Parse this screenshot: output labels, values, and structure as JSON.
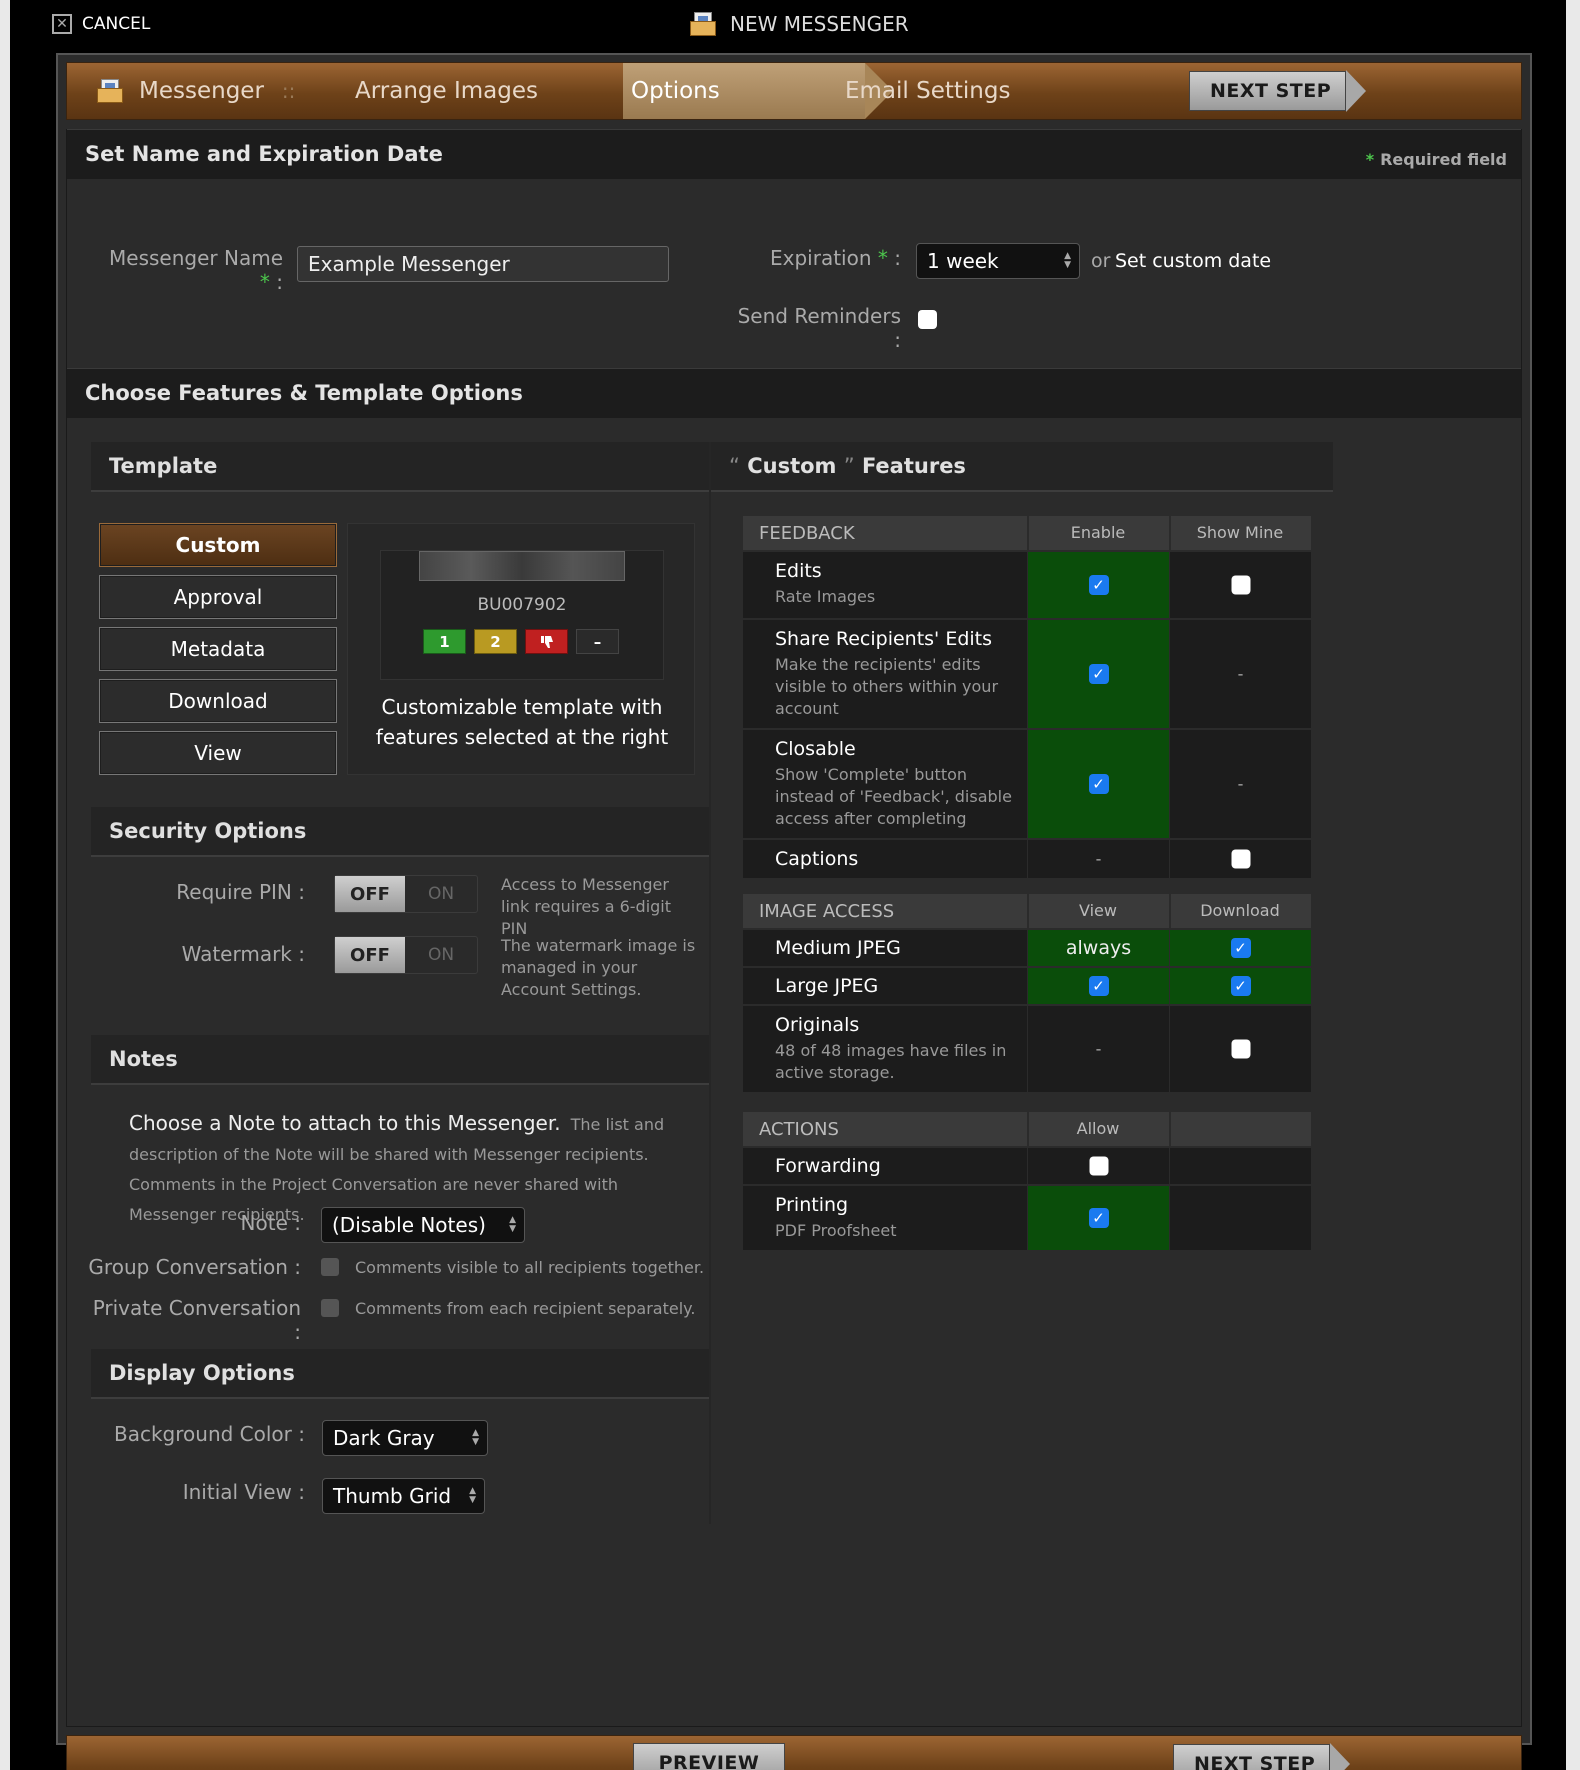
{
  "topbar": {
    "cancel_label": "CANCEL",
    "title": "NEW MESSENGER"
  },
  "steps": {
    "messenger": "Messenger",
    "separator": "::",
    "arrange": "Arrange Images",
    "options": "Options",
    "email": "Email Settings",
    "next_label": "NEXT STEP"
  },
  "section_name": {
    "title": "Set Name and Expiration Date",
    "required_star": "*",
    "required_label": "Required field",
    "name_label": "Messenger Name",
    "name_value": "Example Messenger",
    "expiration_label": "Expiration",
    "expiration_value": "1 week",
    "or_text": "or",
    "custom_date_link": "Set custom date",
    "reminders_label": "Send Reminders :",
    "colon": ":",
    "star": "*"
  },
  "section_features": {
    "title": "Choose Features & Template Options"
  },
  "template": {
    "title": "Template",
    "buttons": [
      "Custom",
      "Approval",
      "Metadata",
      "Download",
      "View"
    ],
    "active": "Custom",
    "preview_id": "BU007902",
    "preview_badges": [
      "1",
      "2",
      "",
      "–"
    ],
    "badge_colors": [
      "#2e9a2e",
      "#b99a22",
      "#c02020",
      "#2a2a2a"
    ],
    "description": "Customizable template with features selected at the right"
  },
  "security": {
    "title": "Security Options",
    "pin_label": "Require PIN :",
    "pin_off": "OFF",
    "pin_on": "ON",
    "pin_help": "Access to Messenger link requires a 6-digit PIN",
    "wm_label": "Watermark :",
    "wm_off": "OFF",
    "wm_on": "ON",
    "wm_help": "The watermark image is managed in your Account Settings."
  },
  "notes": {
    "title": "Notes",
    "lead": "Choose a Note to attach to this Messenger.",
    "desc": "The list and description of the Note will be shared with Messenger recipients. Comments in the Project Conversation are never shared with Messenger recipients.",
    "note_label": "Note :",
    "note_value": "(Disable Notes)",
    "group_label": "Group Conversation :",
    "group_help": "Comments visible to all recipients together.",
    "private_label": "Private Conversation :",
    "private_help": "Comments from each recipient separately."
  },
  "display": {
    "title": "Display Options",
    "bg_label": "Background Color :",
    "bg_value": "Dark Gray",
    "view_label": "Initial View :",
    "view_value": "Thumb Grid"
  },
  "features": {
    "title_quote_open": "“",
    "title_custom": "Custom",
    "title_quote_close": "”",
    "title_rest": "Features",
    "feedback": {
      "header": "FEEDBACK",
      "col1": "Enable",
      "col2": "Show Mine",
      "rows": [
        {
          "name": "Edits",
          "desc": "Rate Images",
          "enable": true,
          "show_mine": false
        },
        {
          "name": "Share Recipients' Edits",
          "desc": "Make the recipients' edits visible to others within your account",
          "enable": true,
          "show_mine": "-"
        },
        {
          "name": "Closable",
          "desc": "Show 'Complete' button instead of 'Feedback', disable access after completing",
          "enable": true,
          "show_mine": "-"
        },
        {
          "name": "Captions",
          "desc": "",
          "enable": "-",
          "show_mine": false
        }
      ]
    },
    "image_access": {
      "header": "IMAGE ACCESS",
      "col1": "View",
      "col2": "Download",
      "rows": [
        {
          "name": "Medium JPEG",
          "desc": "",
          "view": "always",
          "download": true
        },
        {
          "name": "Large JPEG",
          "desc": "",
          "view": true,
          "download": true
        },
        {
          "name": "Originals",
          "desc": "48 of 48 images have files in active storage.",
          "view": "-",
          "download": false
        }
      ]
    },
    "actions": {
      "header": "ACTIONS",
      "col1": "Allow",
      "rows": [
        {
          "name": "Forwarding",
          "desc": "",
          "allow": false
        },
        {
          "name": "Printing",
          "desc": "PDF Proofsheet",
          "allow": true
        }
      ]
    },
    "dash": "-",
    "check": "✓"
  },
  "footer": {
    "preview_label": "PREVIEW",
    "next_label": "NEXT STEP"
  },
  "colors": {
    "accent_brown": "#6e4219",
    "enabled_green": "#0a4d0a",
    "checkbox_blue": "#1a7af0",
    "required_green": "#4cc44c"
  }
}
